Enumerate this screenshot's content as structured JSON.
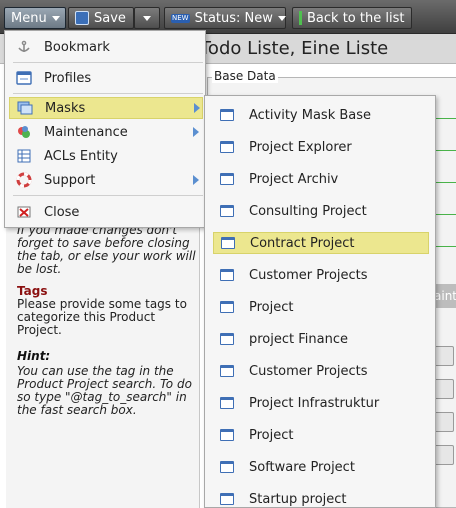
{
  "toolbar": {
    "menu_label": "Menu",
    "save_label": "Save",
    "status_badge": "NEW",
    "status_label": "Status: New",
    "back_label": "Back to the list"
  },
  "page": {
    "title": "Todo Liste, Eine Liste",
    "section_label": "Base Data",
    "grey_button_fragment": "aints"
  },
  "menu": {
    "items": [
      {
        "label": "Bookmark",
        "icon": "anchor-icon"
      },
      {
        "label": "Profiles",
        "icon": "profiles-icon"
      },
      {
        "label": "Masks",
        "icon": "masks-icon",
        "submenu": true,
        "highlighted": true
      },
      {
        "label": "Maintenance",
        "icon": "maintenance-icon",
        "submenu": true
      },
      {
        "label": "ACLs Entity",
        "icon": "acl-icon"
      },
      {
        "label": "Support",
        "icon": "support-icon",
        "submenu": true
      },
      {
        "label": "Close",
        "icon": "close-icon"
      }
    ]
  },
  "submenu": {
    "items": [
      {
        "label": "Activity Mask Base"
      },
      {
        "label": "Project Explorer"
      },
      {
        "label": "Project Archiv"
      },
      {
        "label": "Consulting Project"
      },
      {
        "label": "Contract Project",
        "highlighted": true
      },
      {
        "label": "Customer Projects"
      },
      {
        "label": "Project"
      },
      {
        "label": "project Finance"
      },
      {
        "label": "Customer Projects"
      },
      {
        "label": "Project Infrastruktur"
      },
      {
        "label": "Project"
      },
      {
        "label": "Software Project"
      },
      {
        "label": "Startup project"
      }
    ]
  },
  "help": {
    "save_note": "If you made changes don't forget to save before closing the tab, or else your work will be lost.",
    "tags_head": "Tags",
    "tags_body": "Please provide some tags to categorize this Product Project.",
    "hint_head": "Hint:",
    "hint_body": "You can use the tag in the Product Project search. To do so type \"@tag_to_search\" in the fast search box."
  },
  "colors": {
    "highlight": "#ece78f",
    "accent_blue": "#3f6fb5",
    "tags_heading": "#8b1010"
  }
}
